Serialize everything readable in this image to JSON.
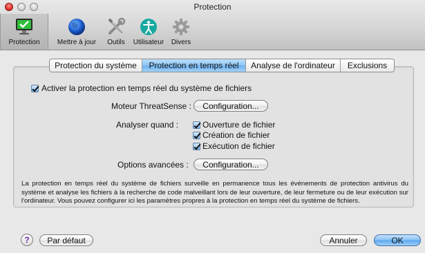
{
  "window": {
    "title": "Protection"
  },
  "toolbar": {
    "items": [
      {
        "label": "Protection",
        "icon": "monitor-check-icon",
        "selected": true
      },
      {
        "label": "Mettre à jour",
        "icon": "globe-update-icon",
        "selected": false
      },
      {
        "label": "Outils",
        "icon": "tools-icon",
        "selected": false
      },
      {
        "label": "Utilisateur",
        "icon": "user-accessibility-icon",
        "selected": false
      },
      {
        "label": "Divers",
        "icon": "gear-icon",
        "selected": false
      }
    ]
  },
  "tabs": [
    {
      "label": "Protection du système",
      "active": false
    },
    {
      "label": "Protection en temps réel",
      "active": true
    },
    {
      "label": "Analyse de l'ordinateur",
      "active": false
    },
    {
      "label": "Exclusions",
      "active": false
    }
  ],
  "realtime": {
    "enable_label": "Activer la protection en temps réel du système de fichiers",
    "enable_checked": true,
    "engine_label": "Moteur ThreatSense :",
    "engine_button": "Configuration...",
    "scan_when_label": "Analyser quand :",
    "scan_options": [
      {
        "label": "Ouverture de fichier",
        "checked": true
      },
      {
        "label": "Création de fichier",
        "checked": true
      },
      {
        "label": "Exécution de fichier",
        "checked": true
      }
    ],
    "advanced_label": "Options avancées :",
    "advanced_button": "Configuration...",
    "description": "La protection en temps réel du système de fichiers surveille en permanence tous les événements de protection antivirus du système et analyse les fichiers à la recherche de code malveillant lors de leur ouverture, de leur fermeture ou de leur exécution sur l'ordinateur. Vous pouvez configurer ici les paramètres propres à la protection en temps réel du système de fichiers."
  },
  "footer": {
    "help_label": "?",
    "default_button": "Par défaut",
    "cancel_button": "Annuler",
    "ok_button": "OK"
  },
  "colors": {
    "accent": "#6fb2ef",
    "close": "#e5312a"
  }
}
